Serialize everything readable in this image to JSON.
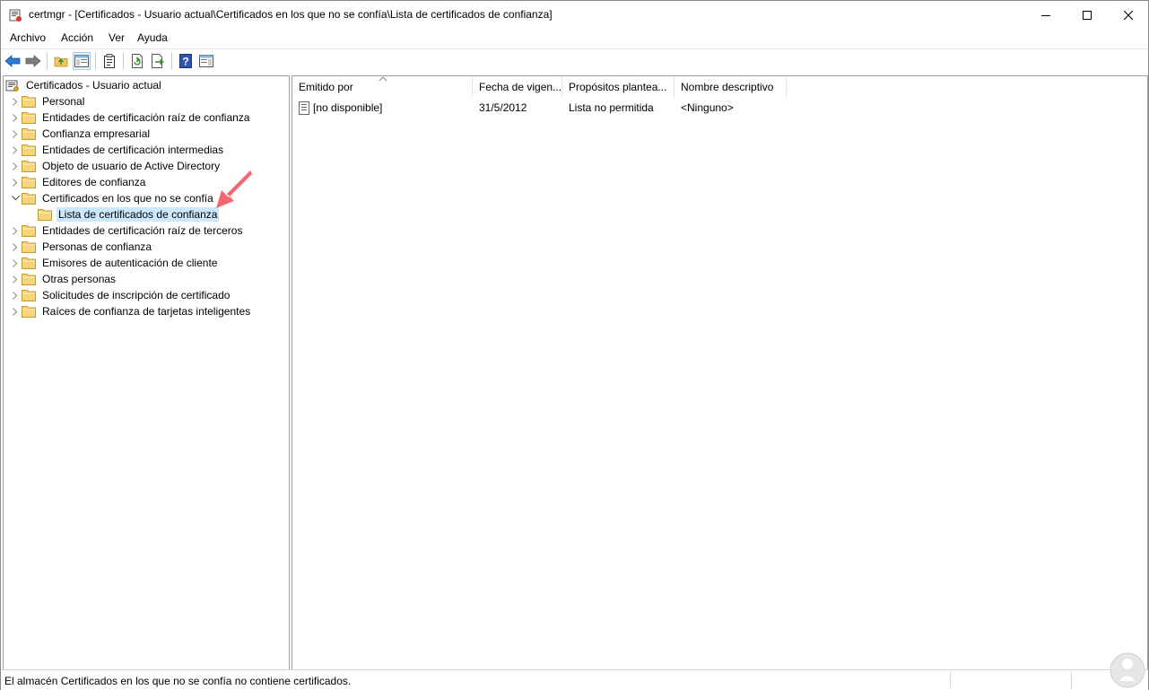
{
  "window": {
    "title": "certmgr - [Certificados - Usuario actual\\Certificados en los que no se confía\\Lista de certificados de confianza]",
    "app_icon": "certmgr-icon"
  },
  "menu": [
    "Archivo",
    "Acción",
    "Ver",
    "Ayuda"
  ],
  "toolbar": {
    "icons": [
      "back-icon",
      "forward-icon",
      "up-folder-icon",
      "show-hide-tree-icon",
      "properties-icon",
      "refresh-icon",
      "export-list-icon",
      "help-icon",
      "action-pane-icon"
    ]
  },
  "tree": {
    "root": "Certificados - Usuario actual",
    "items": [
      {
        "label": "Personal",
        "state": "collapsed"
      },
      {
        "label": "Entidades de certificación raíz de confianza",
        "state": "collapsed"
      },
      {
        "label": "Confianza empresarial",
        "state": "collapsed"
      },
      {
        "label": "Entidades de certificación intermedias",
        "state": "collapsed"
      },
      {
        "label": "Objeto de usuario de Active Directory",
        "state": "collapsed"
      },
      {
        "label": "Editores de confianza",
        "state": "collapsed"
      },
      {
        "label": "Certificados en los que no se confía",
        "state": "expanded"
      },
      {
        "label": "Lista de certificados de confianza",
        "state": "selected-child"
      },
      {
        "label": "Entidades de certificación raíz de terceros",
        "state": "collapsed"
      },
      {
        "label": "Personas de confianza",
        "state": "collapsed"
      },
      {
        "label": "Emisores de autenticación de cliente",
        "state": "collapsed"
      },
      {
        "label": "Otras personas",
        "state": "collapsed"
      },
      {
        "label": "Solicitudes de inscripción de certificado",
        "state": "collapsed"
      },
      {
        "label": "Raíces de confianza de tarjetas inteligentes",
        "state": "collapsed"
      }
    ]
  },
  "list": {
    "columns": [
      "Emitido por",
      "Fecha de vigen...",
      "Propósitos plantea...",
      "Nombre descriptivo"
    ],
    "rows": [
      [
        "[no disponible]",
        "31/5/2012",
        "Lista no permitida",
        "<Ninguno>"
      ]
    ]
  },
  "status": {
    "text": "El almacén Certificados en los que no se confía no contiene certificados."
  },
  "colors": {
    "selection": "#cce8ff",
    "folder": "#f0c85a",
    "annotation_arrow": "#f5666f",
    "accent_blue": "#1e6fd9"
  }
}
